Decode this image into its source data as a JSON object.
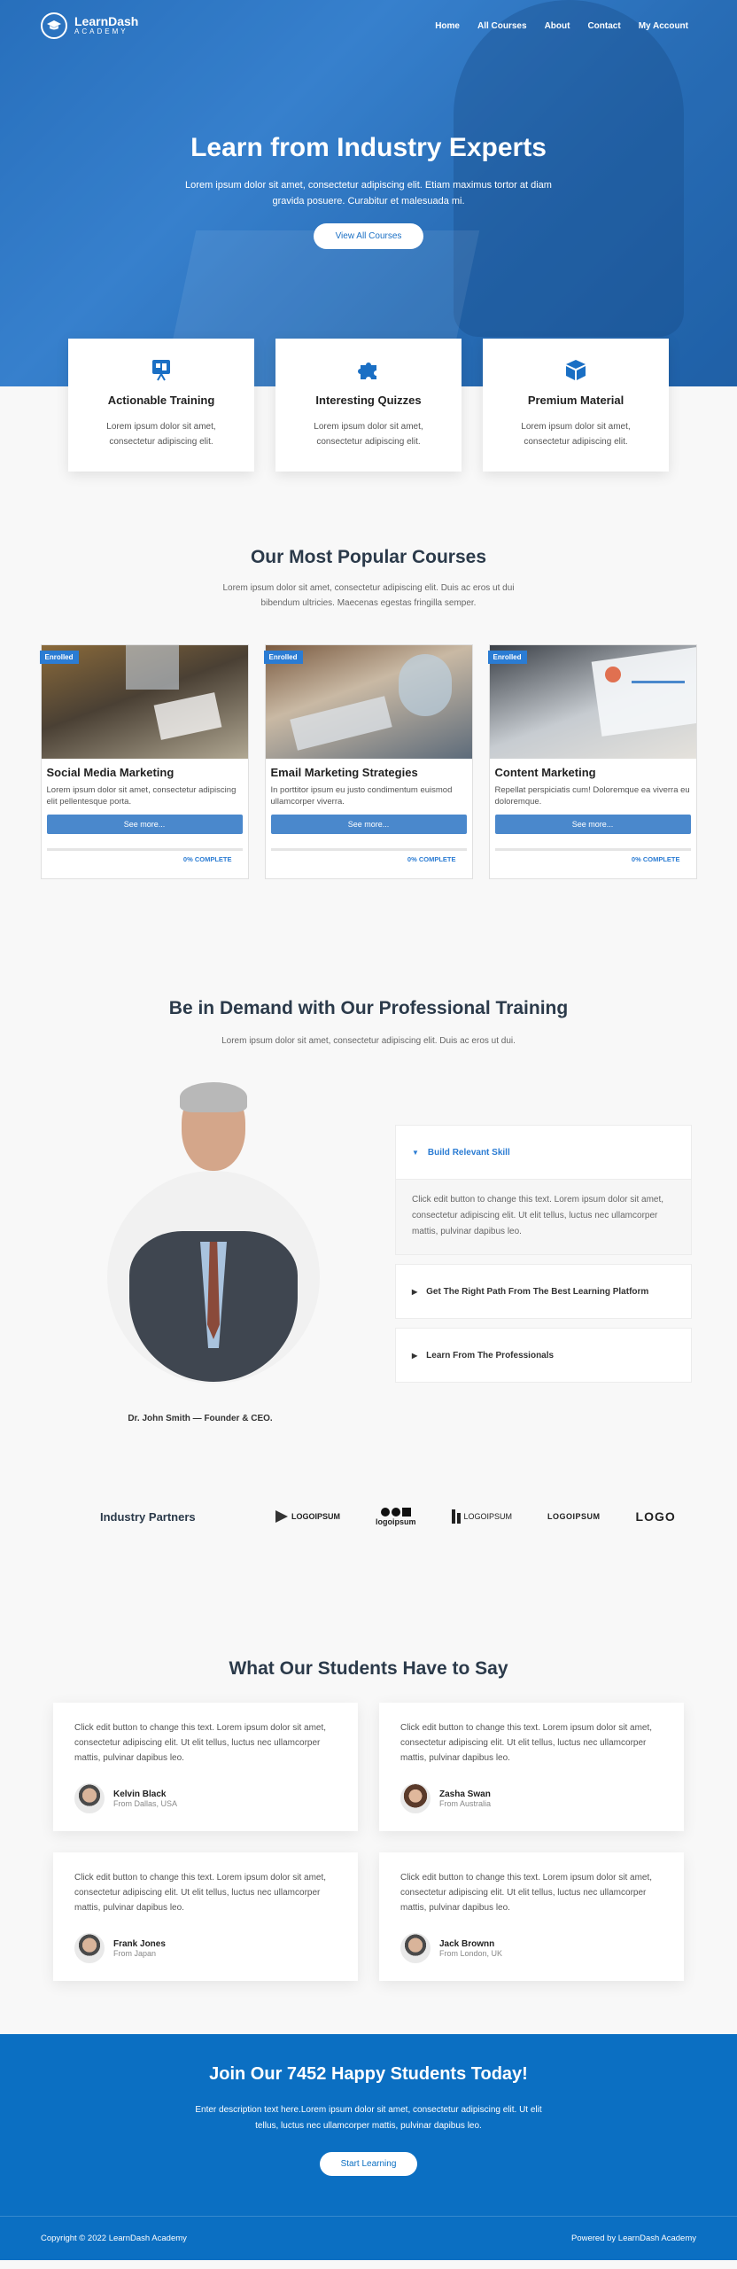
{
  "brand": {
    "name": "LearnDash",
    "tagline": "ACADEMY"
  },
  "nav": [
    "Home",
    "All Courses",
    "About",
    "Contact",
    "My Account"
  ],
  "hero": {
    "title": "Learn from Industry Experts",
    "subtitle": "Lorem ipsum dolor sit amet, consectetur adipiscing elit. Etiam maximus tortor at diam gravida posuere. Curabitur et malesuada mi.",
    "cta": "View All Courses"
  },
  "features": [
    {
      "icon": "slideshow-icon",
      "title": "Actionable Training",
      "text": "Lorem ipsum dolor sit amet, consectetur adipiscing elit."
    },
    {
      "icon": "puzzle-icon",
      "title": "Interesting Quizzes",
      "text": "Lorem ipsum dolor sit amet, consectetur adipiscing elit."
    },
    {
      "icon": "cube-icon",
      "title": "Premium Material",
      "text": "Lorem ipsum dolor sit amet, consectetur adipiscing elit."
    }
  ],
  "courses_section": {
    "title": "Our Most Popular Courses",
    "subtitle": "Lorem ipsum dolor sit amet, consectetur adipiscing elit. Duis ac eros ut dui bibendum ultricies. Maecenas egestas fringilla semper."
  },
  "courses": [
    {
      "badge": "Enrolled",
      "title": "Social Media Marketing",
      "text": "Lorem ipsum dolor sit amet, consectetur adipiscing elit pellentesque porta.",
      "button": "See more...",
      "progress": 0,
      "progress_label": "0% COMPLETE"
    },
    {
      "badge": "Enrolled",
      "title": "Email Marketing Strategies",
      "text": "In porttitor ipsum eu justo condimentum euismod ullamcorper viverra.",
      "button": "See more...",
      "progress": 0,
      "progress_label": "0% COMPLETE"
    },
    {
      "badge": "Enrolled",
      "title": "Content Marketing",
      "text": "Repellat perspiciatis cum! Doloremque ea viverra eu doloremque.",
      "button": "See more...",
      "progress": 0,
      "progress_label": "0% COMPLETE"
    }
  ],
  "demand": {
    "title": "Be in Demand with Our Professional Training",
    "subtitle": "Lorem ipsum dolor sit amet, consectetur adipiscing elit. Duis ac eros ut dui.",
    "caption": "Dr. John Smith — Founder & CEO.",
    "accordion": [
      {
        "title": "Build Relevant Skill",
        "open": true,
        "body": "Click edit button to change this text. Lorem ipsum dolor sit amet, consectetur adipiscing elit. Ut elit tellus, luctus nec ullamcorper mattis, pulvinar dapibus leo."
      },
      {
        "title": "Get The Right Path From The Best Learning Platform",
        "open": false
      },
      {
        "title": "Learn From The Professionals",
        "open": false
      }
    ]
  },
  "partners": {
    "label": "Industry Partners",
    "logos": [
      "LOGOIPSUM",
      "logoipsum",
      "LOGOIPSUM",
      "LOGOIPSUM",
      "LOGO"
    ]
  },
  "testimonials_section": {
    "title": "What Our Students Have to Say"
  },
  "testimonials": [
    {
      "text": "Click edit button to change this text. Lorem ipsum dolor sit amet, consectetur adipiscing elit. Ut elit tellus, luctus nec ullamcorper mattis, pulvinar dapibus leo.",
      "name": "Kelvin Black",
      "location": "From Dallas, USA"
    },
    {
      "text": "Click edit button to change this text. Lorem ipsum dolor sit amet, consectetur adipiscing elit. Ut elit tellus, luctus nec ullamcorper mattis, pulvinar dapibus leo.",
      "name": "Zasha Swan",
      "location": "From Australia"
    },
    {
      "text": "Click edit button to change this text. Lorem ipsum dolor sit amet, consectetur adipiscing elit. Ut elit tellus, luctus nec ullamcorper mattis, pulvinar dapibus leo.",
      "name": "Frank Jones",
      "location": "From Japan"
    },
    {
      "text": "Click edit button to change this text. Lorem ipsum dolor sit amet, consectetur adipiscing elit. Ut elit tellus, luctus nec ullamcorper mattis, pulvinar dapibus leo.",
      "name": "Jack Brownn",
      "location": "From London, UK"
    }
  ],
  "cta": {
    "title": "Join Our 7452 Happy Students Today!",
    "text": "Enter description text here.Lorem ipsum dolor sit amet, consectetur adipiscing elit. Ut elit tellus, luctus nec ullamcorper mattis, pulvinar dapibus leo.",
    "button": "Start Learning"
  },
  "footer": {
    "copyright": "Copyright © 2022 LearnDash Academy",
    "powered": "Powered by LearnDash Academy"
  },
  "colors": {
    "primary": "#0b6fc2",
    "accent": "#2b7cd3",
    "button": "#4a88cc"
  }
}
